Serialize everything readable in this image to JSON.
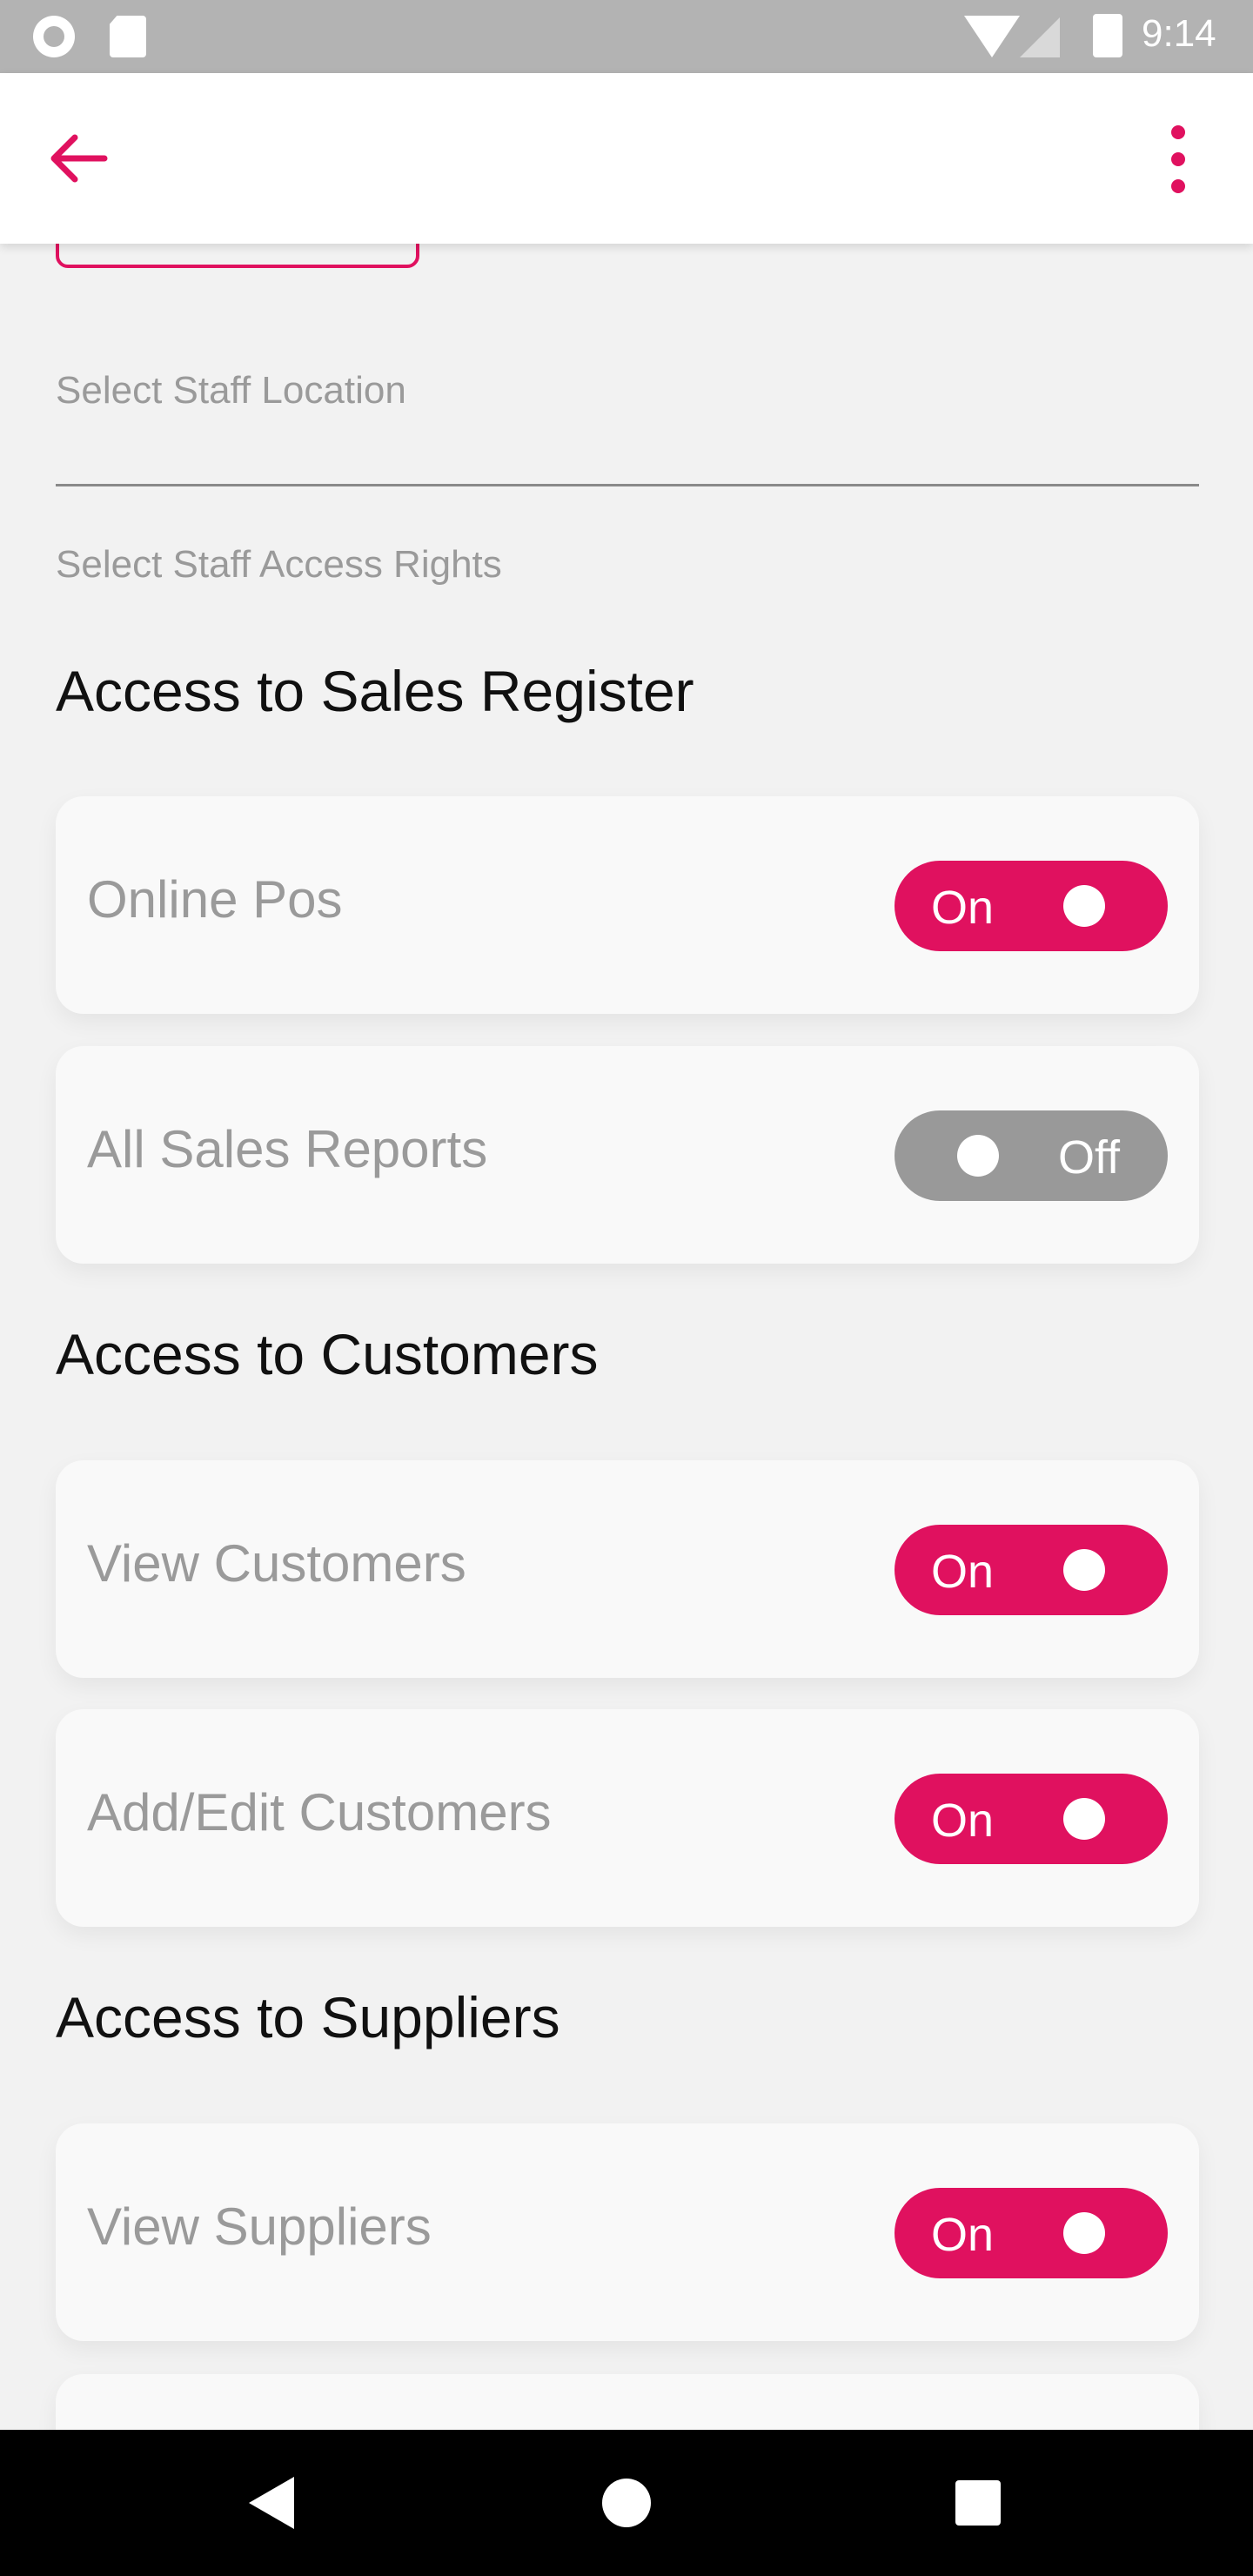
{
  "status_bar": {
    "time": "9:14"
  },
  "app_bar": {
    "back_icon": "arrow-left-icon",
    "menu_icon": "more-vert-icon",
    "accent": "#e0115f"
  },
  "form": {
    "location_label": "Select Staff Location",
    "access_label": "Select Staff Access Rights"
  },
  "sections": [
    {
      "title": "Access to Sales Register",
      "items": [
        {
          "label": "Online Pos",
          "state": "On",
          "on": true
        },
        {
          "label": "All Sales Reports",
          "state": "Off",
          "on": false
        }
      ]
    },
    {
      "title": "Access to Customers",
      "items": [
        {
          "label": "View Customers",
          "state": "On",
          "on": true
        },
        {
          "label": "Add/Edit Customers",
          "state": "On",
          "on": true
        }
      ]
    },
    {
      "title": "Access to Suppliers",
      "items": [
        {
          "label": "View Suppliers",
          "state": "On",
          "on": true
        }
      ]
    }
  ],
  "nav_bar": {
    "back_icon": "nav-back-icon",
    "home_icon": "nav-home-icon",
    "recents_icon": "nav-recents-icon"
  },
  "colors": {
    "toggle_on": "#e0115f",
    "toggle_off": "#999999",
    "card_bg": "#f9f9f9",
    "page_bg": "#f2f2f2"
  }
}
